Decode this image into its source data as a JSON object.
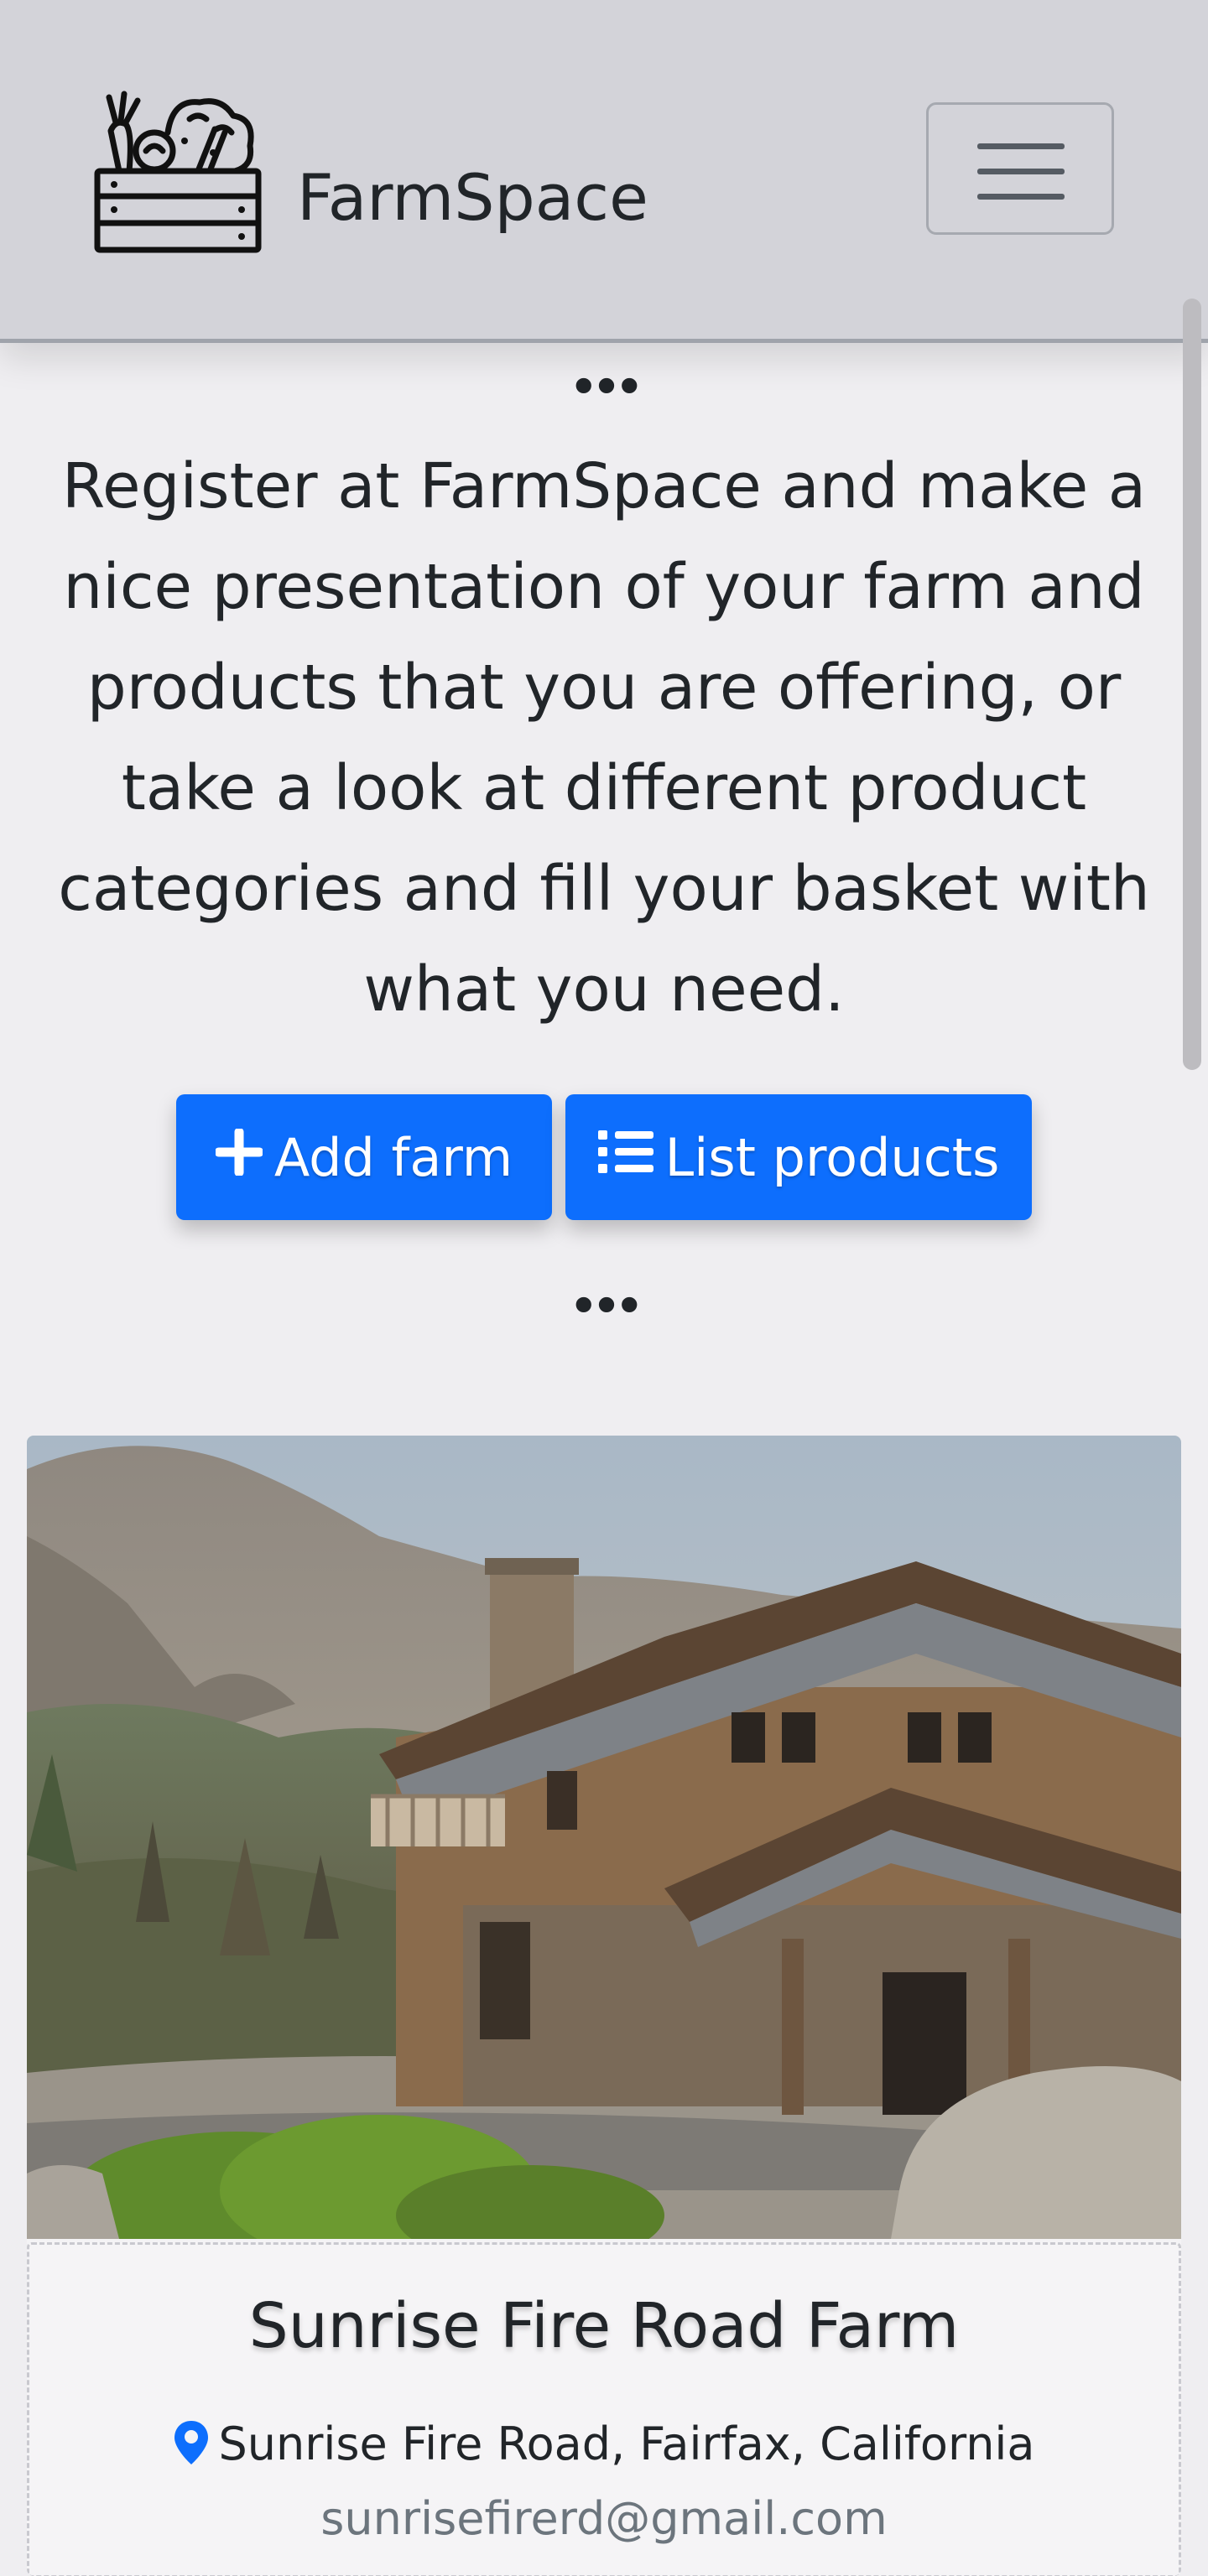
{
  "navbar": {
    "brand": "FarmSpace",
    "logo_icon": "vegetable-crate-icon",
    "toggler_icon": "hamburger-menu-icon"
  },
  "hero": {
    "divider": "•••",
    "lead": "Register at FarmSpace and make a nice presentation of your farm and products that you are offering, or take a look at different product categories and fill your basket with what you need.",
    "add_farm": {
      "icon": "plus-icon",
      "label": "Add farm"
    },
    "list_products": {
      "icon": "list-icon",
      "label": "List products"
    }
  },
  "farm": {
    "image_alt": "Rustic log and stone farmhouse in front of mountains",
    "name": "Sunrise Fire Road Farm",
    "address_icon": "location-pin-icon",
    "address": "Sunrise Fire Road, Fairfax, California",
    "email": "sunrisefirerd@gmail.com"
  },
  "colors": {
    "primary": "#0d6efd",
    "navbar_bg": "#d3d3d9",
    "page_bg": "#efeef1",
    "muted_text": "#6c757d"
  }
}
